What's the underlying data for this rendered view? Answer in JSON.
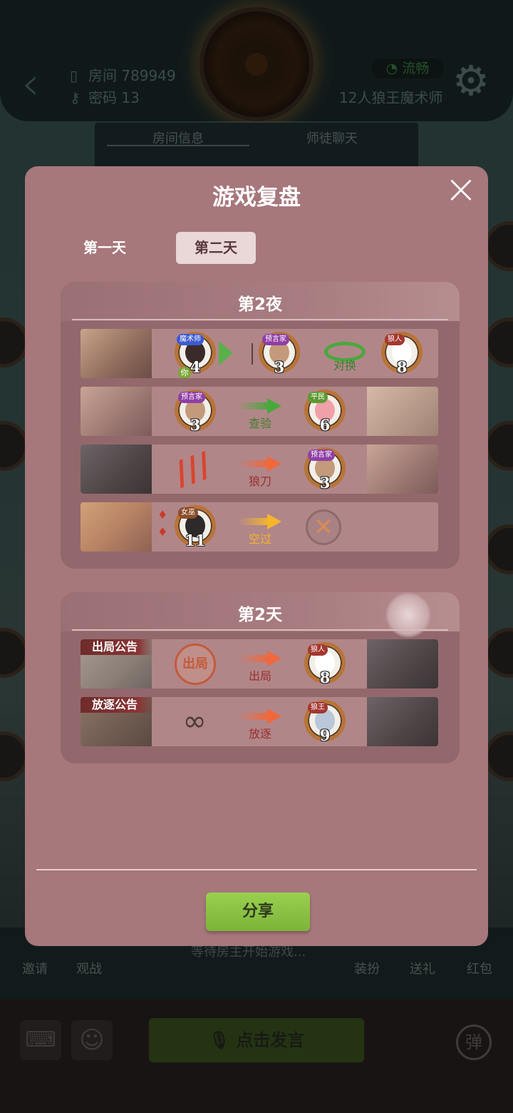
{
  "header": {
    "room_label": "房间 789949",
    "password_label": "密码 13",
    "signal": "流畅",
    "game_mode": "12人狼王魔术师",
    "tabs": [
      "房间信息",
      "师徒聊天"
    ]
  },
  "toolbar": {
    "invite": "邀请",
    "watch": "观战",
    "waiting": "等待房主开始游戏...",
    "dress": "装扮",
    "gift": "送礼",
    "red_packet": "红包",
    "speak": "点击发言",
    "danmu": "弹"
  },
  "modal": {
    "title": "游戏复盘",
    "day_tabs": [
      "第一天",
      "第二天"
    ],
    "active_tab": "第二天",
    "night": {
      "title": "第2夜",
      "rows": [
        {
          "actor": {
            "role": "魔术师",
            "number": "4",
            "you": "你"
          },
          "targets": [
            {
              "role": "预言家",
              "number": "3"
            },
            {
              "role": "狼人",
              "number": "8"
            }
          ],
          "action": "对换"
        },
        {
          "actor": {
            "role": "预言家",
            "number": "3"
          },
          "target": {
            "role": "平民",
            "number": "6"
          },
          "action": "查验"
        },
        {
          "target": {
            "role": "预言家",
            "number": "3"
          },
          "action": "狼刀"
        },
        {
          "actor": {
            "role": "女巫",
            "number": "11"
          },
          "action": "空过"
        }
      ]
    },
    "day": {
      "title": "第2天",
      "rows": [
        {
          "tag": "出局公告",
          "stamp": "出局",
          "action": "出局",
          "target": {
            "role": "狼人",
            "number": "8"
          }
        },
        {
          "tag": "放逐公告",
          "action": "放逐",
          "target": {
            "role": "狼王",
            "number": "9"
          }
        }
      ]
    },
    "share": "分享"
  },
  "colors": {
    "modal_bg": "#a6777b",
    "section_bg": "#93686c",
    "row_bg": "#b18689",
    "share_green": "#8cc544",
    "arrow_green": "#49a83c",
    "arrow_red": "#f0683c",
    "arrow_yellow": "#f5b62c"
  },
  "icons": [
    "back-icon",
    "door-icon",
    "key-icon",
    "wifi-icon",
    "gear-icon",
    "close-icon",
    "keyboard-icon",
    "emoji-icon",
    "microphone-icon",
    "danmu-icon"
  ]
}
